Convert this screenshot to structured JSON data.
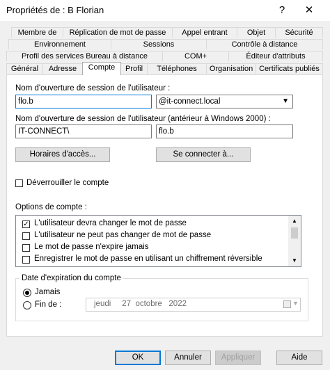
{
  "window": {
    "title": "Propriétés de : B Florian",
    "help_label": "?",
    "close_label": "✕"
  },
  "tabs": {
    "row1": [
      "Membre de",
      "Réplication de mot de passe",
      "Appel entrant",
      "Objet",
      "Sécurité"
    ],
    "row2": [
      "Environnement",
      "Sessions",
      "Contrôle à distance"
    ],
    "row3": [
      "Profil des services Bureau à distance",
      "COM+",
      "Éditeur d'attributs"
    ],
    "row4": [
      "Général",
      "Adresse",
      "Compte",
      "Profil",
      "Téléphones",
      "Organisation",
      "Certificats publiés"
    ],
    "active": "Compte"
  },
  "account": {
    "logon_label": "Nom d'ouverture de session de l'utilisateur :",
    "logon_value": "flo.b",
    "domain_value": "@it-connect.local",
    "legacy_label": "Nom d'ouverture de session de l'utilisateur (antérieur à Windows 2000) :",
    "legacy_domain": "IT-CONNECT\\",
    "legacy_user": "flo.b",
    "hours_button": "Horaires d'accès...",
    "logon_to_button": "Se connecter à...",
    "unlock_label": "Déverrouiller le compte",
    "unlock_checked": false
  },
  "options": {
    "label": "Options de compte :",
    "items": [
      {
        "text": "L'utilisateur devra changer le mot de passe",
        "checked": true
      },
      {
        "text": "L'utilisateur ne peut pas changer de mot de passe",
        "checked": false
      },
      {
        "text": "Le mot de passe n'expire jamais",
        "checked": false
      },
      {
        "text": "Enregistrer le mot de passe en utilisant un chiffrement réversible",
        "checked": false
      }
    ]
  },
  "expiry": {
    "title": "Date d'expiration du compte",
    "never_label": "Jamais",
    "end_label": "Fin de :",
    "selected": "Jamais",
    "date_value": "jeudi     27  octobre   2022"
  },
  "footer": {
    "ok": "OK",
    "cancel": "Annuler",
    "apply": "Appliquer",
    "help": "Aide"
  },
  "colors": {
    "accent": "#0078d7",
    "panel": "#ffffff",
    "background": "#f0f0f0"
  },
  "icons": {
    "check": "✓",
    "dropdown": "chevron-down-icon",
    "calendar": "calendar-icon"
  }
}
